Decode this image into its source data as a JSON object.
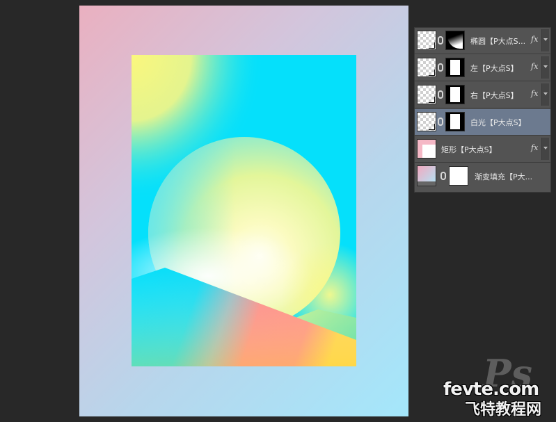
{
  "layers_panel": {
    "layers": [
      {
        "name": "椭圆【P大点S...",
        "fx": "fx",
        "mask": "gradient",
        "selected": false
      },
      {
        "name": "左【P大点S】",
        "fx": "fx",
        "mask": "black-white",
        "selected": false
      },
      {
        "name": "右【P大点S】",
        "fx": "fx",
        "mask": "black-white",
        "selected": false
      },
      {
        "name": "白光【P大点S】",
        "fx": "",
        "mask": "black-white",
        "selected": true
      },
      {
        "name": "矩形【P大点S】",
        "fx": "fx",
        "mask": "none",
        "selected": false
      },
      {
        "name": "渐变填充【P大...",
        "fx": "",
        "mask": "white",
        "selected": false
      }
    ]
  },
  "watermark": {
    "ps": "Ps",
    "site": "fevte.com",
    "site_cn": "飞特教程网"
  },
  "colors": {
    "workspace": "#282828",
    "panel": "#535353",
    "selected_layer": "#6c7a8f",
    "cyan": "#05e0fb",
    "yellow": "#fbf87a",
    "coral": "#fd8a8a"
  }
}
